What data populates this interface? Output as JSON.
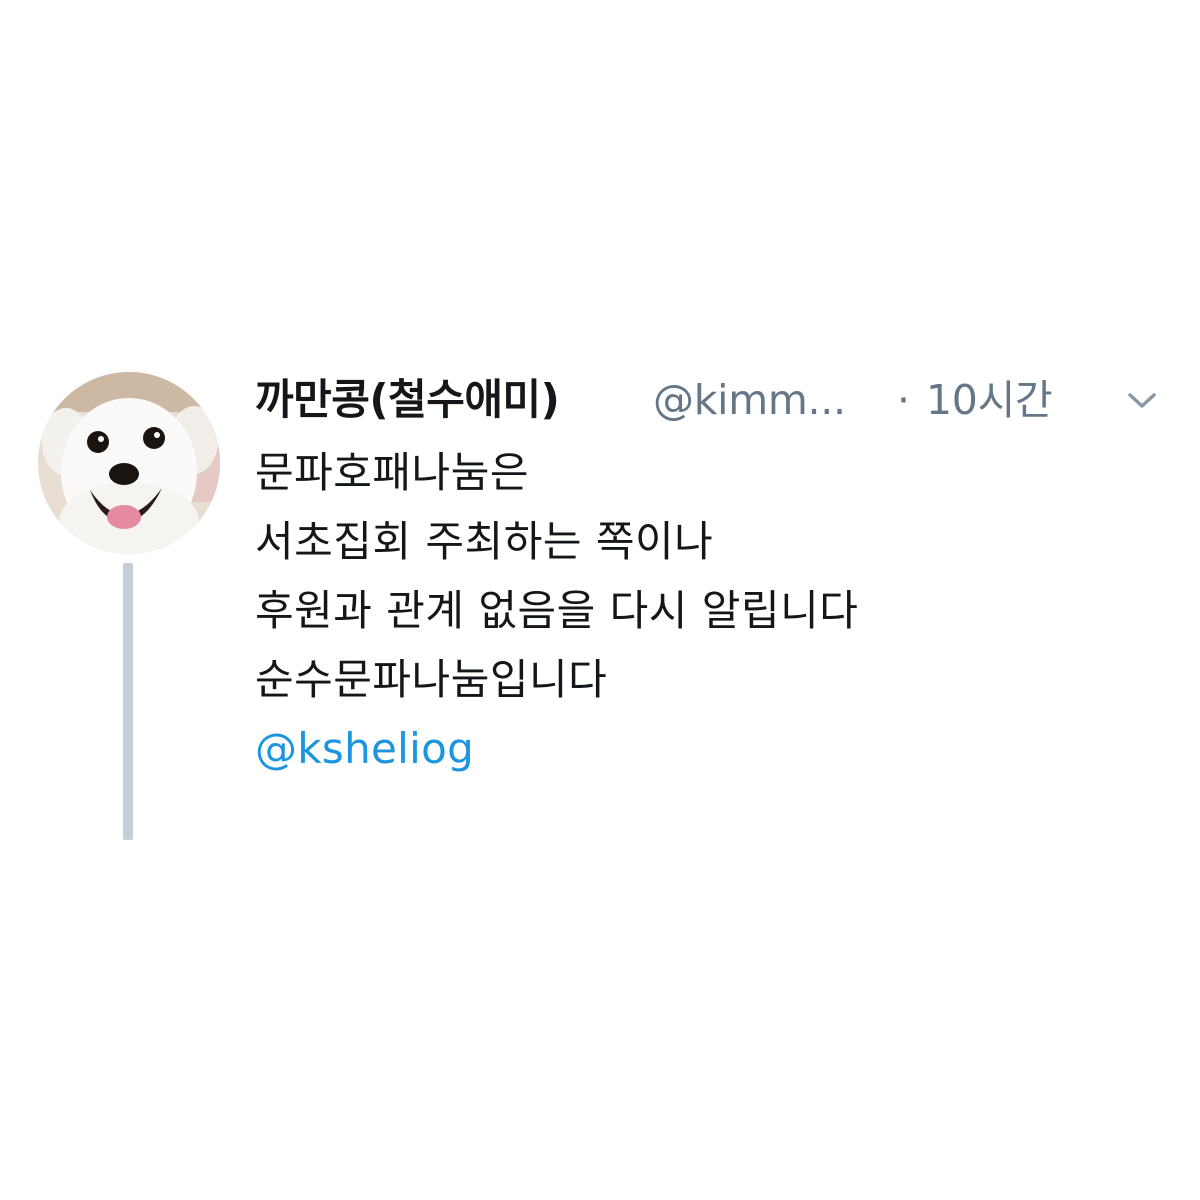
{
  "tweet": {
    "display_name": "까만콩(철수애미)",
    "handle": "@kimm...",
    "separator": "·",
    "timestamp": "10시간",
    "lines": [
      "문파호패나눔은",
      "서초집회 주최하는 쪽이나",
      "후원과 관계 없음을 다시 알립니다",
      "순수문파나눔입니다"
    ],
    "mention": "@ksheliog",
    "avatar_icon": "dog-avatar",
    "caret_icon": "chevron-down-icon"
  },
  "colors": {
    "name": "#14171a",
    "secondary": "#657786",
    "link": "#1b95e0",
    "thread_line": "#c4ced6",
    "background": "#ffffff"
  }
}
